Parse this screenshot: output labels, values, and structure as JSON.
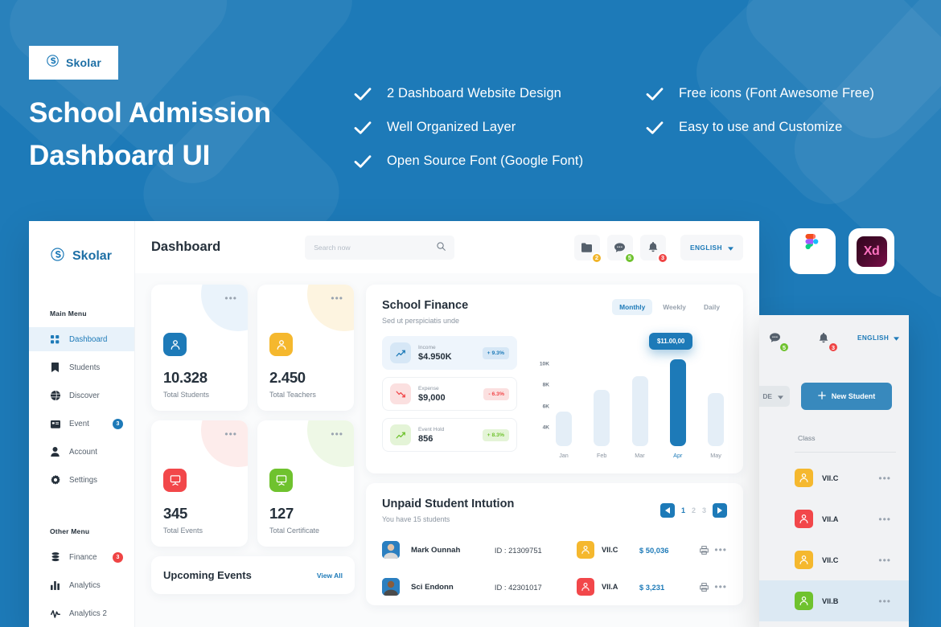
{
  "brand": {
    "name": "Skolar",
    "logo_icon": "skolar-s-logo-icon",
    "accent": "#1d7ab8"
  },
  "hero": {
    "title": "School Admission\nDashboard UI"
  },
  "features": {
    "check_icon": "check-icon",
    "column1": [
      "2 Dashboard Website Design",
      "Well Organized Layer",
      "Open Source Font (Google Font)"
    ],
    "column2": [
      "Free icons (Font Awesome Free)",
      "Easy to use and Customize"
    ]
  },
  "tools": [
    {
      "name": "Figma",
      "icon": "figma-icon"
    },
    {
      "name": "Adobe XD",
      "icon": "adobe-xd-icon",
      "label": "Xd"
    }
  ],
  "app": {
    "sidebar": {
      "brand": "Skolar",
      "sections": [
        {
          "label": "Main Menu",
          "items": [
            {
              "label": "Dashboard",
              "icon": "grid-icon",
              "active": true,
              "badge": null
            },
            {
              "label": "Students",
              "icon": "bookmark-icon",
              "active": false,
              "badge": null
            },
            {
              "label": "Discover",
              "icon": "globe-icon",
              "active": false,
              "badge": null
            },
            {
              "label": "Event",
              "icon": "calendar-icon",
              "active": false,
              "badge": "3",
              "badge_color": "#1d7ab8"
            },
            {
              "label": "Account",
              "icon": "user-icon",
              "active": false,
              "badge": null
            },
            {
              "label": "Settings",
              "icon": "gear-icon",
              "active": false,
              "badge": null
            }
          ]
        },
        {
          "label": "Other Menu",
          "items": [
            {
              "label": "Finance",
              "icon": "coins-icon",
              "active": false,
              "badge": "3",
              "badge_color": "#ef4444"
            },
            {
              "label": "Analytics",
              "icon": "bar-chart-icon",
              "active": false,
              "badge": null
            },
            {
              "label": "Analytics 2",
              "icon": "pulse-icon",
              "active": false,
              "badge": null
            }
          ]
        }
      ]
    },
    "topbar": {
      "title": "Dashboard",
      "search": {
        "placeholder": "Search now",
        "icon": "search-icon"
      },
      "icons": [
        {
          "name": "folder-icon",
          "badge": "2",
          "badge_color": "#f0b429"
        },
        {
          "name": "chat-icon",
          "badge": "5",
          "badge_color": "#6fc22e"
        },
        {
          "name": "bell-icon",
          "badge": "3",
          "badge_color": "#ef4444"
        }
      ],
      "language": {
        "label": "ENGLISH",
        "caret_icon": "chevron-down-icon"
      }
    },
    "stats": [
      {
        "value": "10.328",
        "label": "Total Students",
        "icon": "student-icon",
        "color": "#1d7ab8",
        "ring": "#eaf3fb",
        "menu_icon": "more-icon"
      },
      {
        "value": "2.450",
        "label": "Total Teachers",
        "icon": "teacher-icon",
        "color": "#f5b82e",
        "ring": "#fdf4e0",
        "menu_icon": "more-icon"
      },
      {
        "value": "345",
        "label": "Total Events",
        "icon": "board-icon",
        "color": "#f2474a",
        "ring": "#fdecec",
        "menu_icon": "more-icon"
      },
      {
        "value": "127",
        "label": "Total Certificate",
        "icon": "certificate-icon",
        "color": "#6fc22e",
        "ring": "#eef8e6",
        "menu_icon": "more-icon"
      }
    ],
    "upcoming_events": {
      "title": "Upcoming Events",
      "view_all": "View All"
    },
    "finance": {
      "title": "School Finance",
      "subtitle": "Sed ut perspiciatis unde",
      "tabs": [
        {
          "label": "Monthly",
          "active": true
        },
        {
          "label": "Weekly",
          "active": false
        },
        {
          "label": "Daily",
          "active": false
        }
      ],
      "metrics": [
        {
          "label": "Income",
          "value": "$4.950K",
          "change": "+ 9.3%",
          "icon": "trend-up-icon",
          "tone": "blue",
          "highlighted": true
        },
        {
          "label": "Expense",
          "value": "$9,000",
          "change": "- 6.3%",
          "icon": "trend-down-icon",
          "tone": "red",
          "highlighted": false
        },
        {
          "label": "Event Hold",
          "value": "856",
          "change": "+ 8.3%",
          "icon": "trend-up-icon",
          "tone": "green",
          "highlighted": false
        }
      ],
      "tooltip": "$11.00,00"
    },
    "unpaid": {
      "title": "Unpaid Student Intution",
      "subtitle": "You have 15 students",
      "pager": {
        "prev_icon": "chevron-left-icon",
        "next_icon": "chevron-right-icon",
        "pages": [
          "1",
          "2",
          "3"
        ],
        "current": "1"
      },
      "rows": [
        {
          "avatar": "student-photo-avatar",
          "name": "Mark Ounnah",
          "id": "ID : 21309751",
          "class": "VII.C",
          "class_color": "#f5b82e",
          "amount": "$ 50,036",
          "print_icon": "printer-icon",
          "menu_icon": "more-icon"
        },
        {
          "avatar": "student-photo-avatar",
          "name": "Sci Endonn",
          "id": "ID : 42301017",
          "class": "VII.A",
          "class_color": "#f2474a",
          "amount": "$ 3,231",
          "print_icon": "printer-icon",
          "menu_icon": "more-icon"
        }
      ]
    }
  },
  "float_panel": {
    "icons": [
      {
        "name": "chat-icon",
        "badge": "5",
        "badge_color": "#6fc22e"
      },
      {
        "name": "bell-icon",
        "badge": "3",
        "badge_color": "#ef4444"
      }
    ],
    "language": {
      "label": "ENGLISH",
      "caret_icon": "chevron-down-icon"
    },
    "grade_chip": {
      "label": "DE",
      "caret_icon": "chevron-down-icon"
    },
    "new_student_button": {
      "label": "New Student",
      "icon": "plus-icon"
    },
    "class_label": "Class",
    "classes": [
      {
        "label": "VII.C",
        "color": "#f5b82e",
        "icon": "student-icon",
        "menu_icon": "more-icon",
        "selected": false
      },
      {
        "label": "VII.A",
        "color": "#f2474a",
        "icon": "student-icon",
        "menu_icon": "more-icon",
        "selected": false
      },
      {
        "label": "VII.C",
        "color": "#f5b82e",
        "icon": "student-icon",
        "menu_icon": "more-icon",
        "selected": false
      },
      {
        "label": "VII.B",
        "color": "#6fc22e",
        "icon": "student-icon",
        "menu_icon": "more-icon",
        "selected": true
      }
    ]
  },
  "chart_data": {
    "type": "bar",
    "title": "School Finance",
    "subtitle": "Sed ut perspiciatis unde",
    "categories": [
      "Jan",
      "Feb",
      "Mar",
      "Apr",
      "May"
    ],
    "values": [
      6.2,
      8.3,
      9.5,
      11.0,
      8.0
    ],
    "value_labels": [
      "",
      "",
      "",
      "$11.00,00",
      ""
    ],
    "highlight_index": 3,
    "ytick_labels": [
      "10K",
      "8K",
      "6K",
      "4K"
    ],
    "ytick_values": [
      10,
      8,
      6,
      4
    ],
    "ylim": [
      3,
      11.6
    ],
    "xlabel": "",
    "ylabel": "",
    "grid": false,
    "legend": false,
    "bar_color": "#e4eef7",
    "highlight_color": "#1d7ab8"
  }
}
